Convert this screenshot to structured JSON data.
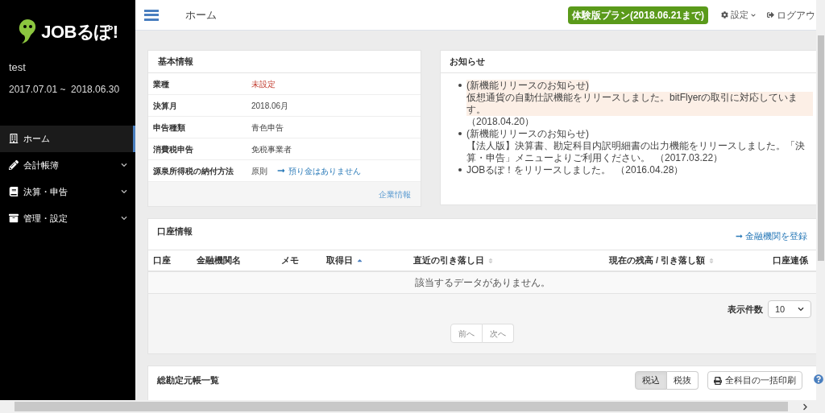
{
  "sidebar": {
    "brand": "JOBるぽ!",
    "user": "test",
    "period": "2017.07.01 ~  2018.06.30",
    "items": [
      {
        "label": "ホーム",
        "selected": true,
        "has_submenu": false
      },
      {
        "label": "会計帳簿",
        "selected": false,
        "has_submenu": true
      },
      {
        "label": "決算・申告",
        "selected": false,
        "has_submenu": true
      },
      {
        "label": "管理・設定",
        "selected": false,
        "has_submenu": true
      }
    ]
  },
  "header": {
    "title": "ホーム",
    "plan_badge": "体験版プラン(2018.06.21まで)",
    "settings": "設定",
    "logout": "ログアウ"
  },
  "basic_info": {
    "title": "基本情報",
    "rows": [
      {
        "label": "業種",
        "value": "未設定",
        "alert": true
      },
      {
        "label": "決算月",
        "value": "2018.06月",
        "alert": false
      },
      {
        "label": "申告種類",
        "value": "青色申告",
        "alert": false
      },
      {
        "label": "消費税申告",
        "value": "免税事業者",
        "alert": false
      },
      {
        "label": "源泉所得税の納付方法",
        "value": "原則",
        "alert": false,
        "link": "預り金はありません"
      }
    ],
    "footer_link": "企業情報"
  },
  "notices": {
    "title": "お知らせ",
    "items": [
      {
        "heading": "(新機能リリースのお知らせ)",
        "body": "仮想通貨の自動仕訳機能をリリースしました。bitFlyerの取引に対応しています。",
        "date": "（2018.04.20）",
        "highlighted": true
      },
      {
        "heading": "(新機能リリースのお知らせ)",
        "body": "【法人版】決算書、勘定科目内訳明細書の出力機能をリリースしました。「決算・申告」メニューよりご利用ください。",
        "date": "（2017.03.22）",
        "highlighted": false
      },
      {
        "body": "JOBるぽ！をリリースしました。",
        "date": "（2016.04.28）",
        "highlighted": false
      }
    ]
  },
  "accounts": {
    "title": "口座情報",
    "register_link": "金融機関を登録",
    "columns": [
      {
        "label": "口座",
        "sorted": false,
        "sortable": false
      },
      {
        "label": "金融機関名",
        "sorted": false,
        "sortable": false
      },
      {
        "label": "メモ",
        "sorted": false,
        "sortable": false
      },
      {
        "label": "取得日",
        "sorted": true,
        "sortable": true
      },
      {
        "label": "直近の引き落し日",
        "sorted": false,
        "sortable": true
      },
      {
        "label": "現在の残高 / 引き落し額",
        "sorted": false,
        "sortable": true
      },
      {
        "label": "口座連係",
        "sorted": false,
        "sortable": false
      }
    ],
    "empty_message": "該当するデータがありません。",
    "page_size_label": "表示件数",
    "page_size": "10",
    "prev": "前へ",
    "next": "次へ"
  },
  "ledger": {
    "title": "総勘定元帳一覧",
    "tax_tabs": [
      {
        "label": "税込",
        "selected": true
      },
      {
        "label": "税抜",
        "selected": false
      }
    ],
    "print_button": "全科目の一括印刷"
  }
}
